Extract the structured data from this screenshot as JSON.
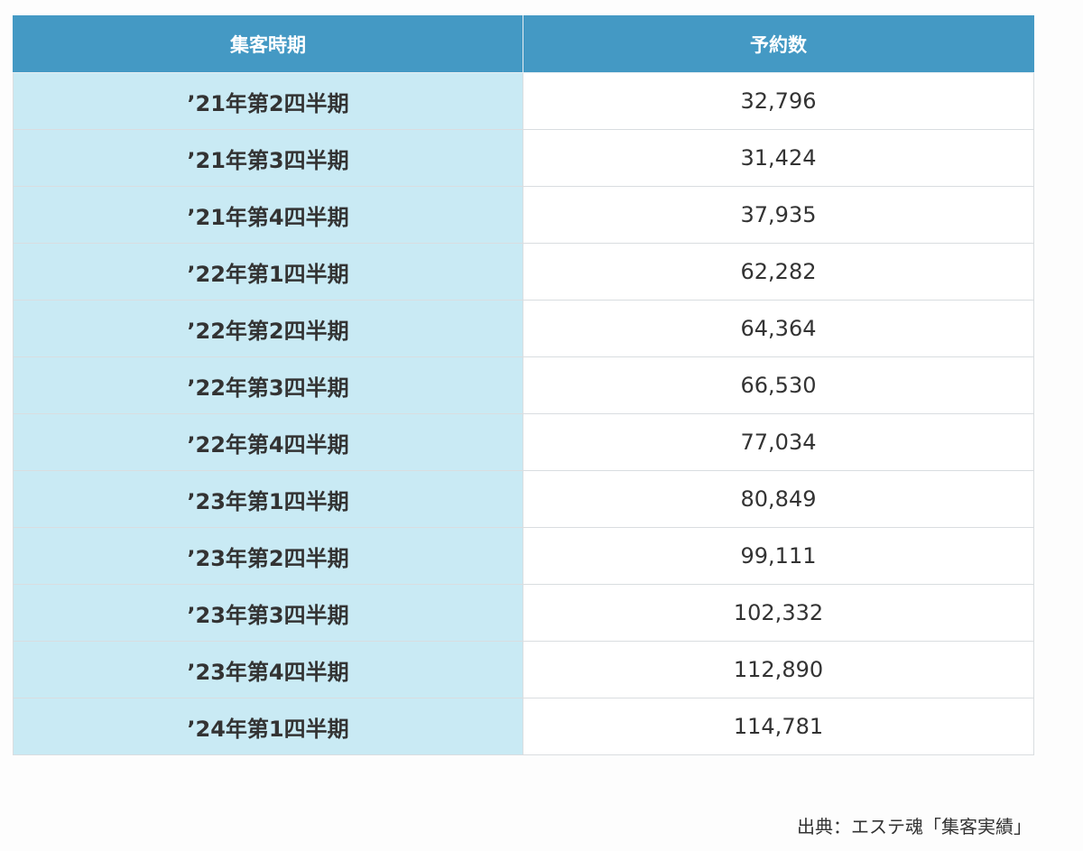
{
  "table": {
    "headers": {
      "period": "集客時期",
      "reservations": "予約数"
    },
    "rows": [
      {
        "period": "’21年第2四半期",
        "reservations": "32,796"
      },
      {
        "period": "’21年第3四半期",
        "reservations": "31,424"
      },
      {
        "period": "’21年第4四半期",
        "reservations": "37,935"
      },
      {
        "period": "’22年第1四半期",
        "reservations": "62,282"
      },
      {
        "period": "’22年第2四半期",
        "reservations": "64,364"
      },
      {
        "period": "’22年第3四半期",
        "reservations": "66,530"
      },
      {
        "period": "’22年第4四半期",
        "reservations": "77,034"
      },
      {
        "period": "’23年第1四半期",
        "reservations": "80,849"
      },
      {
        "period": "’23年第2四半期",
        "reservations": "99,111"
      },
      {
        "period": "’23年第3四半期",
        "reservations": "102,332"
      },
      {
        "period": "’23年第4四半期",
        "reservations": "112,890"
      },
      {
        "period": "’24年第1四半期",
        "reservations": "114,781"
      }
    ]
  },
  "source_note": "出典：エステ魂「集客実績」",
  "colors": {
    "header_bg": "#4499c4",
    "header_text": "#ffffff",
    "period_cell_bg": "#c9eaf4",
    "value_cell_bg": "#ffffff",
    "border": "#d9dde0",
    "text": "#333333"
  }
}
